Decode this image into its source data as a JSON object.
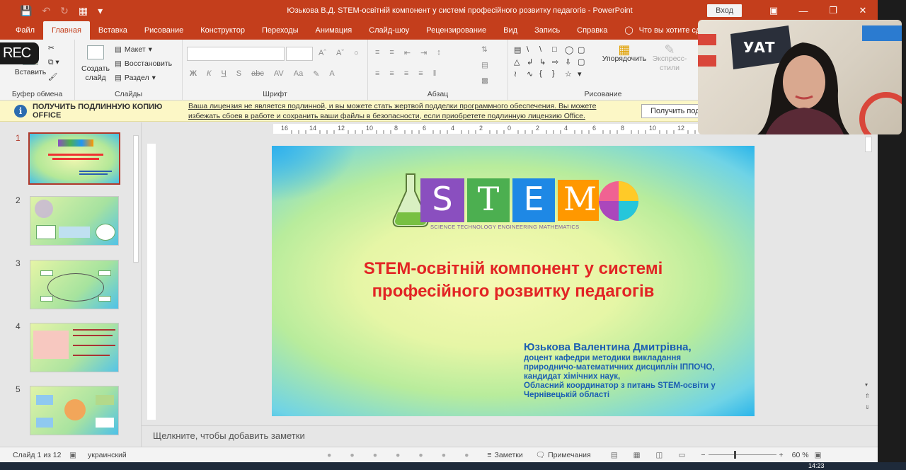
{
  "titlebar": {
    "title": "Юзькова В.Д. STEM-освітній компонент у системі професійного розвитку педагогів  -  PowerPoint",
    "signin": "Вход"
  },
  "tabs": [
    "Файл",
    "Главная",
    "Вставка",
    "Рисование",
    "Конструктор",
    "Переходы",
    "Анимация",
    "Слайд-шоу",
    "Рецензирование",
    "Вид",
    "Запись",
    "Справка"
  ],
  "tellme": "Что вы хотите сдел",
  "ribbon": {
    "clipboard": {
      "label": "Буфер обмена",
      "paste": "Вставить"
    },
    "slides": {
      "label": "Слайды",
      "new_slide": "Создать слайд",
      "layout": "Макет",
      "reset": "Восстановить",
      "section": "Раздел"
    },
    "font": {
      "label": "Шрифт"
    },
    "paragraph": {
      "label": "Абзац"
    },
    "drawing": {
      "label": "Рисование",
      "arrange": "Упорядочить",
      "styles": "Экспресс-стили"
    }
  },
  "infobar": {
    "title": "ПОЛУЧИТЬ ПОДЛИННУЮ КОПИЮ OFFICE",
    "message": "Ваша лицензия не является подлинной, и вы можете стать жертвой подделки программного обеспечения. Вы можете избежать сбоев в работе и сохранить ваши файлы в безопасности, если приобретете подлинную лицензию Office.",
    "button": "Получить подли"
  },
  "ruler": [
    "16",
    "14",
    "12",
    "10",
    "8",
    "6",
    "4",
    "2",
    "0",
    "2",
    "4",
    "6",
    "8",
    "10",
    "12"
  ],
  "thumbnails": [
    {
      "num": "1",
      "selected": true
    },
    {
      "num": "2",
      "selected": false
    },
    {
      "num": "3",
      "selected": false
    },
    {
      "num": "4",
      "selected": false
    },
    {
      "num": "5",
      "selected": false
    }
  ],
  "slide": {
    "logo_letters": [
      "S",
      "T",
      "E",
      "M"
    ],
    "logo_caption": "SCIENCE  TECHNOLOGY  ENGINEERING  MATHEMATICS",
    "title_line1": "STEM-освітній компонент у системі",
    "title_line2": "професійного розвитку педагогів",
    "author_name": "Юзькова Валентина Дмитрівна,",
    "author_lines": [
      "доцент кафедри методики викладання",
      "природничо-математичних дисциплін ІППОЧО,",
      "кандидат хімічних наук,",
      "Обласний координатор з питань STEM-освіти у",
      "Чернівецькій області"
    ]
  },
  "notes_placeholder": "Щелкните, чтобы добавить заметки",
  "status": {
    "slide_count": "Слайд 1 из 12",
    "language": "украинский",
    "notes": "Заметки",
    "comments": "Примечания",
    "zoom": "60 %",
    "clock": "14:23"
  },
  "overlay": {
    "rec": "REC"
  },
  "colors": {
    "accent": "#c43e1c",
    "slide_title": "#e22424",
    "author": "#1b5fb3"
  }
}
